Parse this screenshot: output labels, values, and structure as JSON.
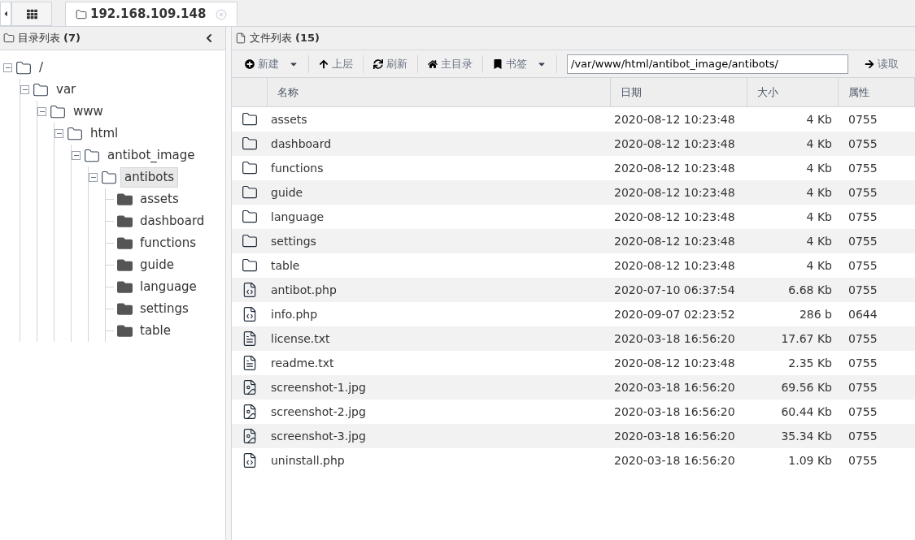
{
  "tabs": [
    {
      "label": "192.168.109.148",
      "selected": true
    }
  ],
  "dir_panel": {
    "title": "目录列表",
    "count": "(7)"
  },
  "tree": [
    {
      "label": "/",
      "expanded": true,
      "selected": false,
      "children": [
        {
          "label": "var",
          "expanded": true,
          "selected": false,
          "children": [
            {
              "label": "www",
              "expanded": true,
              "selected": false,
              "children": [
                {
                  "label": "html",
                  "expanded": true,
                  "selected": false,
                  "children": [
                    {
                      "label": "antibot_image",
                      "expanded": true,
                      "selected": false,
                      "children": [
                        {
                          "label": "antibots",
                          "expanded": true,
                          "selected": true,
                          "children": [
                            {
                              "label": "assets",
                              "selected": false
                            },
                            {
                              "label": "dashboard",
                              "selected": false
                            },
                            {
                              "label": "functions",
                              "selected": false
                            },
                            {
                              "label": "guide",
                              "selected": false
                            },
                            {
                              "label": "language",
                              "selected": false
                            },
                            {
                              "label": "settings",
                              "selected": false
                            },
                            {
                              "label": "table",
                              "selected": false
                            }
                          ]
                        }
                      ]
                    }
                  ]
                }
              ]
            }
          ]
        }
      ]
    }
  ],
  "file_panel": {
    "title": "文件列表",
    "count": "(15)"
  },
  "toolbar": [
    {
      "kind": "new",
      "label": "新建",
      "dropdown": true
    },
    {
      "kind": "up",
      "label": "上层",
      "dropdown": false
    },
    {
      "kind": "refresh",
      "label": "刷新",
      "dropdown": false
    },
    {
      "kind": "home",
      "label": "主目录",
      "dropdown": false
    },
    {
      "kind": "bookmark",
      "label": "书签",
      "dropdown": true
    }
  ],
  "path": {
    "value": "/var/www/html/antibot_image/antibots/"
  },
  "read_button": "读取",
  "table": {
    "columns": [
      "名称",
      "日期",
      "大小",
      "属性"
    ],
    "rows": [
      {
        "kind": "folder",
        "name": "assets",
        "date": "2020-08-12 10:23:48",
        "size": "4 Kb",
        "mode": "0755"
      },
      {
        "kind": "folder",
        "name": "dashboard",
        "date": "2020-08-12 10:23:48",
        "size": "4 Kb",
        "mode": "0755"
      },
      {
        "kind": "folder",
        "name": "functions",
        "date": "2020-08-12 10:23:48",
        "size": "4 Kb",
        "mode": "0755"
      },
      {
        "kind": "folder",
        "name": "guide",
        "date": "2020-08-12 10:23:48",
        "size": "4 Kb",
        "mode": "0755"
      },
      {
        "kind": "folder",
        "name": "language",
        "date": "2020-08-12 10:23:48",
        "size": "4 Kb",
        "mode": "0755"
      },
      {
        "kind": "folder",
        "name": "settings",
        "date": "2020-08-12 10:23:48",
        "size": "4 Kb",
        "mode": "0755"
      },
      {
        "kind": "folder",
        "name": "table",
        "date": "2020-08-12 10:23:48",
        "size": "4 Kb",
        "mode": "0755"
      },
      {
        "kind": "code",
        "name": "antibot.php",
        "date": "2020-07-10 06:37:54",
        "size": "6.68 Kb",
        "mode": "0755"
      },
      {
        "kind": "code",
        "name": "info.php",
        "date": "2020-09-07 02:23:52",
        "size": "286 b",
        "mode": "0644"
      },
      {
        "kind": "text",
        "name": "license.txt",
        "date": "2020-03-18 16:56:20",
        "size": "17.67 Kb",
        "mode": "0755"
      },
      {
        "kind": "text",
        "name": "readme.txt",
        "date": "2020-08-12 10:23:48",
        "size": "2.35 Kb",
        "mode": "0755"
      },
      {
        "kind": "image",
        "name": "screenshot-1.jpg",
        "date": "2020-03-18 16:56:20",
        "size": "69.56 Kb",
        "mode": "0755"
      },
      {
        "kind": "image",
        "name": "screenshot-2.jpg",
        "date": "2020-03-18 16:56:20",
        "size": "60.44 Kb",
        "mode": "0755"
      },
      {
        "kind": "image",
        "name": "screenshot-3.jpg",
        "date": "2020-03-18 16:56:20",
        "size": "35.34 Kb",
        "mode": "0755"
      },
      {
        "kind": "code",
        "name": "uninstall.php",
        "date": "2020-03-18 16:56:20",
        "size": "1.09 Kb",
        "mode": "0755"
      }
    ]
  }
}
